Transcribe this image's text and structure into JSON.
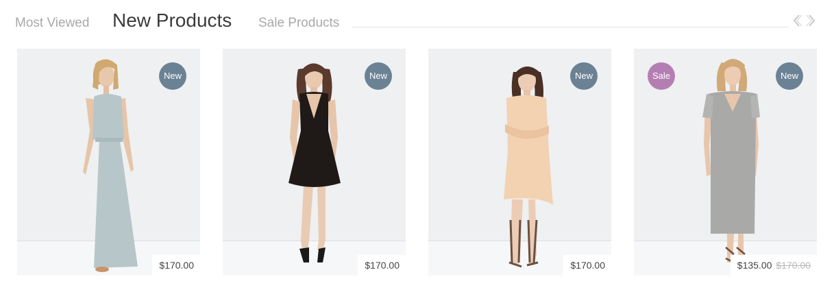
{
  "tabs": [
    {
      "label": "Most Viewed",
      "active": false
    },
    {
      "label": "New Products",
      "active": true
    },
    {
      "label": "Sale Products",
      "active": false
    }
  ],
  "carousel": {
    "prev_icon": "chevron-left-icon",
    "next_icon": "chevron-right-icon"
  },
  "products": [
    {
      "badge_new": "New",
      "price": "$170.00",
      "dress_color": "#b7c6c9"
    },
    {
      "badge_new": "New",
      "price": "$170.00",
      "dress_color": "#1f1a18"
    },
    {
      "badge_new": "New",
      "price": "$170.00",
      "dress_color": "#f3d2b2"
    },
    {
      "badge_new": "New",
      "badge_sale": "Sale",
      "price": "$135.00",
      "old_price": "$170.00",
      "dress_color": "#a9a9a7"
    }
  ],
  "colors": {
    "badge_new": "#6b8194",
    "badge_sale": "#b57eb3",
    "active_tab": "#3b3b3b",
    "inactive_tab": "#a9a9a9"
  }
}
